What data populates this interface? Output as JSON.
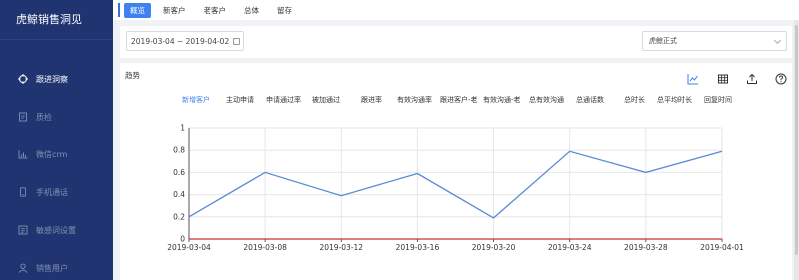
{
  "sidebar": {
    "brand": "虎鲸销售洞见",
    "items": [
      {
        "label": "跟进洞察",
        "icon": "target-icon",
        "active": true
      },
      {
        "label": "质检",
        "icon": "document-icon",
        "active": false
      },
      {
        "label": "微信crm",
        "icon": "bar-chart-icon",
        "active": false
      },
      {
        "label": "手机通话",
        "icon": "phone-icon",
        "active": false
      },
      {
        "label": "敏感词设置",
        "icon": "list-icon",
        "active": false
      },
      {
        "label": "销售用户",
        "icon": "user-icon",
        "active": false
      }
    ]
  },
  "tabs": [
    {
      "label": "概览",
      "active": true
    },
    {
      "label": "新客户",
      "active": false
    },
    {
      "label": "老客户",
      "active": false
    },
    {
      "label": "总体",
      "active": false
    },
    {
      "label": "留存",
      "active": false
    }
  ],
  "filters": {
    "date_range": "2019-03-04 ~ 2019-04-02",
    "org_select": "虎鲸正式"
  },
  "card": {
    "title": "趋势",
    "toolbar": [
      "line-chart-icon",
      "table-icon",
      "export-icon",
      "help-icon"
    ]
  },
  "colors": {
    "sidebar_bg": "#1f3470",
    "accent": "#3d82f0",
    "line": "#5b8ad6",
    "baseline": "#c23531"
  },
  "chart_data": {
    "type": "line",
    "legend": [
      "新增客户",
      "主动申请",
      "申请通过率",
      "被加通过",
      "跟进率",
      "有效沟通率",
      "跟进客户-老",
      "有效沟通-老",
      "总有效沟通",
      "总通话数",
      "总时长",
      "总平均时长",
      "回复时间"
    ],
    "selected_series": "新增客户",
    "x": [
      "2019-03-04",
      "2019-03-08",
      "2019-03-12",
      "2019-03-16",
      "2019-03-20",
      "2019-03-24",
      "2019-03-28",
      "2019-04-01"
    ],
    "series": [
      {
        "name": "新增客户",
        "values": [
          0.2,
          0.6,
          0.39,
          0.59,
          0.19,
          0.79,
          0.6,
          0.79
        ]
      },
      {
        "name": "baseline",
        "values": [
          0,
          0,
          0,
          0,
          0,
          0,
          0,
          0
        ]
      }
    ],
    "ylim": [
      0,
      1
    ],
    "yticks": [
      "0",
      "0.2",
      "0.4",
      "0.6",
      "0.8",
      "1"
    ],
    "grid": true
  }
}
